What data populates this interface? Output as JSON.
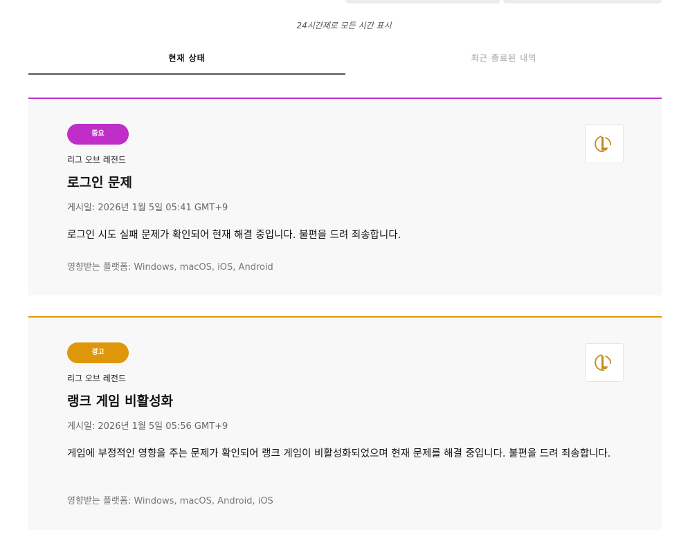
{
  "timezone_note": "24시간제로 모든 시간 표시",
  "tabs": [
    {
      "label": "현재 상태",
      "active": true
    },
    {
      "label": "최근 종료된 내역",
      "active": false
    }
  ],
  "logo_icon": "league-of-legends-logo",
  "incidents": [
    {
      "severity": "중요",
      "accent_color": "#c02ec8",
      "product": "리그 오브 레전드",
      "title": "로그인 문제",
      "posted": "게시일: 2026년 1월 5일 05:41 GMT+9",
      "description": "로그인 시도 실패 문제가 확인되어 현재 해결 중입니다. 불편을 드려 죄송합니다.",
      "platforms": "영향받는 플랫폼: Windows, macOS, iOS, Android"
    },
    {
      "severity": "경고",
      "accent_color": "#e0960a",
      "product": "리그 오브 레전드",
      "title": "랭크 게임 비활성화",
      "posted": "게시일: 2026년 1월 5일 05:56 GMT+9",
      "description": "게임에 부정적인 영향을 주는 문제가 확인되어 랭크 게임이 비활성화되었으며 현재 문제를 해결 중입니다. 불편을 드려 죄송합니다.",
      "platforms": "영향받는 플랫폼: Windows, macOS, Android, iOS"
    }
  ]
}
